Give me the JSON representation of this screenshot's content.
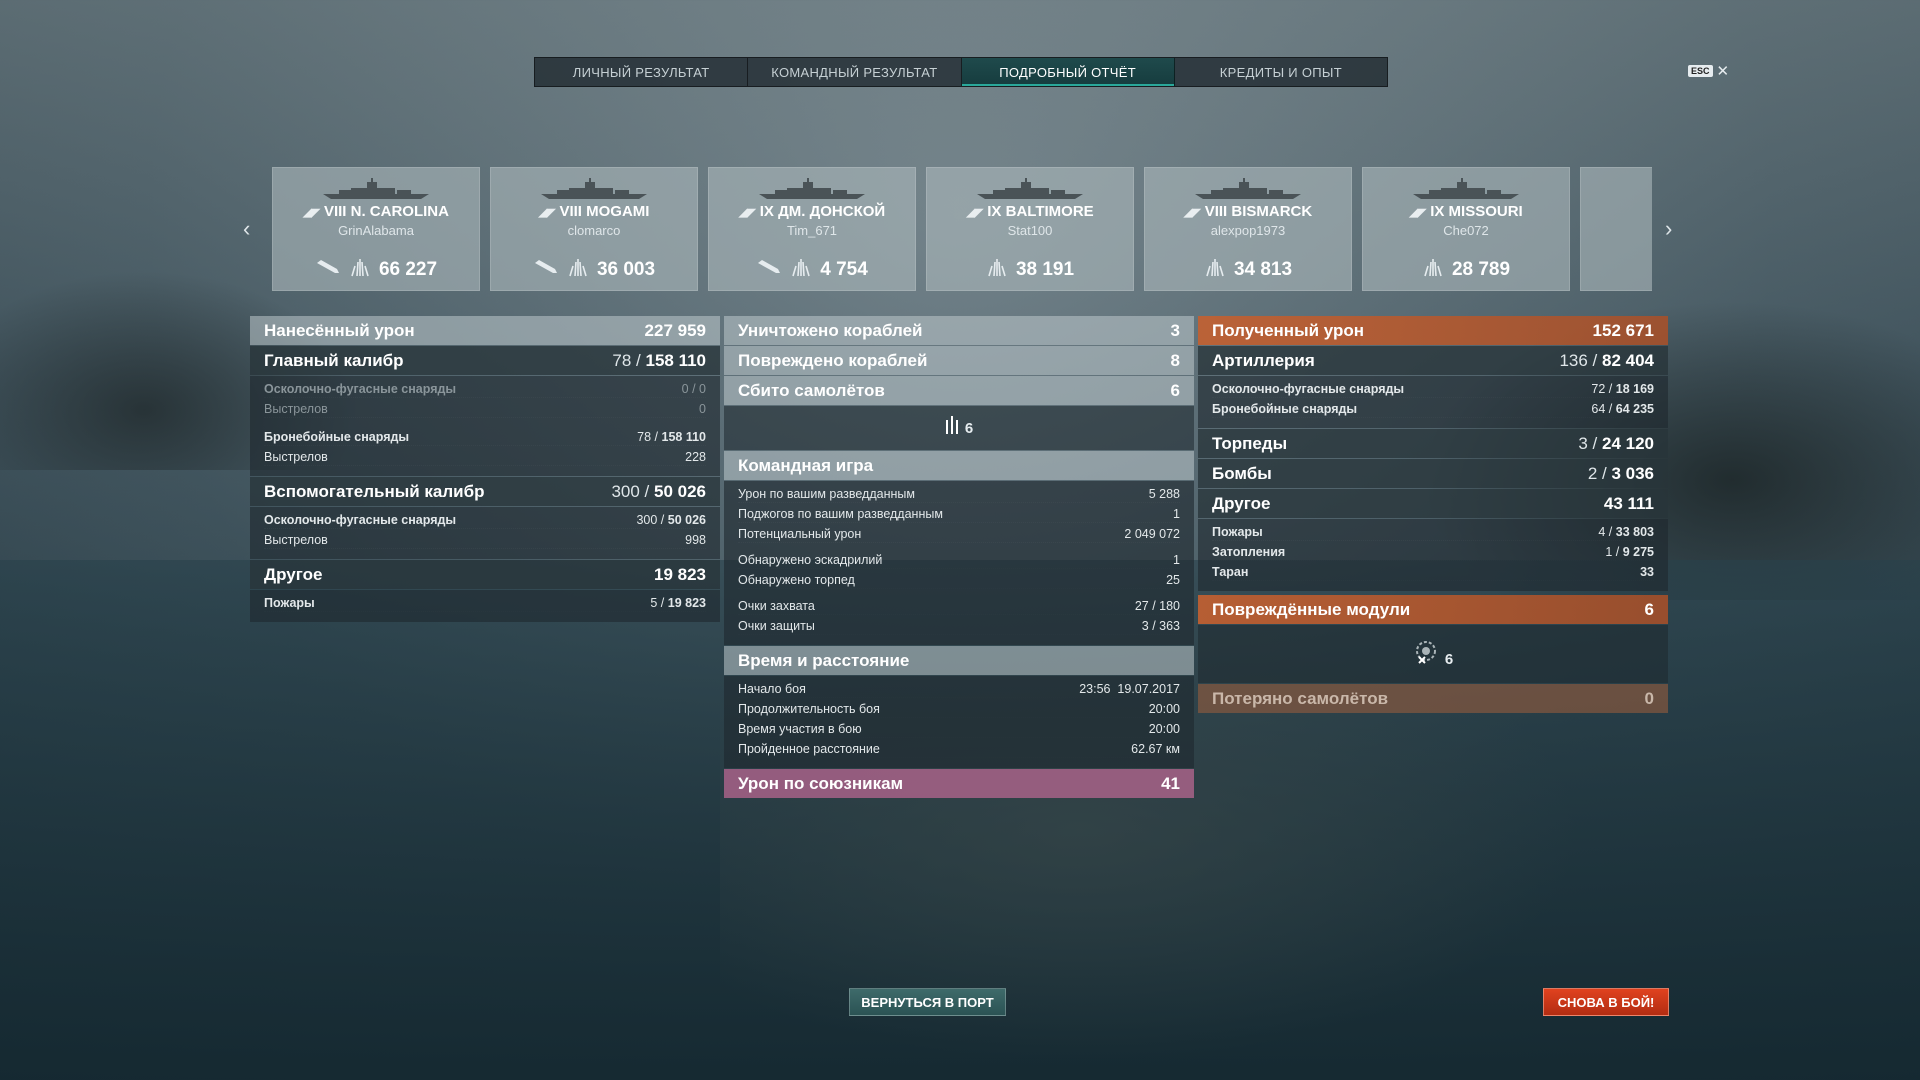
{
  "tabs": [
    {
      "label": "ЛИЧНЫЙ РЕЗУЛЬТАТ"
    },
    {
      "label": "КОМАНДНЫЙ РЕЗУЛЬТАТ"
    },
    {
      "label": "ПОДРОБНЫЙ ОТЧЁТ",
      "active": true
    },
    {
      "label": "КРЕДИТЫ И ОПЫТ"
    }
  ],
  "esc_key": "ESC",
  "ships": [
    {
      "tier": "VIII",
      "name": "N. CAROLINA",
      "player": "GrinAlabama",
      "damage": "66 227",
      "torpedo": true
    },
    {
      "tier": "VIII",
      "name": "MOGAMI",
      "player": "clomarco",
      "damage": "36 003",
      "torpedo": true
    },
    {
      "tier": "IX",
      "name": "ДМ. ДОНСКОЙ",
      "player": "Tim_671",
      "damage": "4 754",
      "torpedo": true
    },
    {
      "tier": "IX",
      "name": "BALTIMORE",
      "player": "Stat100",
      "damage": "38 191",
      "torpedo": false
    },
    {
      "tier": "VIII",
      "name": "BISMARCK",
      "player": "alexpop1973",
      "damage": "34 813",
      "torpedo": false
    },
    {
      "tier": "IX",
      "name": "MISSOURI",
      "player": "Che072",
      "damage": "28 789",
      "torpedo": false
    }
  ],
  "left": {
    "dealt": {
      "label": "Нанесённый урон",
      "value": "227 959"
    },
    "main": {
      "label": "Главный калибр",
      "hits": "78",
      "value": "158 110"
    },
    "main_lines": [
      {
        "label": "Осколочно-фугасные снаряды",
        "value": "0 / 0"
      },
      {
        "label": "Выстрелов",
        "value": "0"
      },
      {
        "label": "Бронебойные снаряды",
        "hits": "78 /",
        "value": "158 110"
      },
      {
        "label": "Выстрелов",
        "value": "228"
      }
    ],
    "secondary": {
      "label": "Вспомогательный калибр",
      "hits": "300",
      "value": "50 026"
    },
    "secondary_lines": [
      {
        "label": "Осколочно-фугасные снаряды",
        "hits": "300 /",
        "value": "50 026"
      },
      {
        "label": "Выстрелов",
        "value": "998"
      }
    ],
    "other": {
      "label": "Другое",
      "value": "19 823"
    },
    "other_lines": [
      {
        "label": "Пожары",
        "hits": "5 /",
        "value": "19 823"
      }
    ]
  },
  "center": {
    "destroyed": {
      "label": "Уничтожено кораблей",
      "value": "3"
    },
    "damaged": {
      "label": "Повреждено кораблей",
      "value": "8"
    },
    "planes": {
      "label": "Сбито самолётов",
      "value": "6"
    },
    "planes_icon_count": "6",
    "team": {
      "label": "Командная игра"
    },
    "team_lines": [
      {
        "label": "Урон по вашим разведданным",
        "value": "5 288"
      },
      {
        "label": "Поджогов по вашим разведданным",
        "value": "1"
      },
      {
        "label": "Потенциальный урон",
        "value": "2 049 072"
      },
      {
        "label": "Обнаружено эскадрилий",
        "value": "1"
      },
      {
        "label": "Обнаружено торпед",
        "value": "25"
      },
      {
        "label": "Очки захвата",
        "value": "27 / 180"
      },
      {
        "label": "Очки защиты",
        "value": "3 / 363"
      }
    ],
    "time": {
      "label": "Время и расстояние"
    },
    "time_lines": [
      {
        "label": "Начало боя",
        "value": "23:56  19.07.2017"
      },
      {
        "label": "Продолжительность боя",
        "value": "20:00"
      },
      {
        "label": "Время участия в бою",
        "value": "20:00"
      },
      {
        "label": "Пройденное расстояние",
        "value": "62.67 км"
      }
    ],
    "ally": {
      "label": "Урон по союзникам",
      "value": "41"
    }
  },
  "right": {
    "received": {
      "label": "Полученный урон",
      "value": "152 671"
    },
    "artillery": {
      "label": "Артиллерия",
      "hits": "136",
      "value": "82 404"
    },
    "artillery_lines": [
      {
        "label": "Осколочно-фугасные снаряды",
        "hits": "72 /",
        "value": "18 169"
      },
      {
        "label": "Бронебойные снаряды",
        "hits": "64 /",
        "value": "64 235"
      }
    ],
    "torpedoes": {
      "label": "Торпеды",
      "hits": "3",
      "value": "24 120"
    },
    "bombs": {
      "label": "Бомбы",
      "hits": "2",
      "value": "3 036"
    },
    "other": {
      "label": "Другое",
      "value": "43 111"
    },
    "other_lines": [
      {
        "label": "Пожары",
        "hits": "4 /",
        "value": "33 803"
      },
      {
        "label": "Затопления",
        "hits": "1 /",
        "value": "9 275"
      },
      {
        "label": "Таран",
        "value": "33"
      }
    ],
    "modules": {
      "label": "Повреждённые модули",
      "value": "6"
    },
    "modules_icon_count": "6",
    "lost_planes": {
      "label": "Потеряно самолётов",
      "value": "0"
    }
  },
  "buttons": {
    "port": "ВЕРНУТЬСЯ В ПОРТ",
    "battle": "СНОВА В БОЙ!"
  }
}
